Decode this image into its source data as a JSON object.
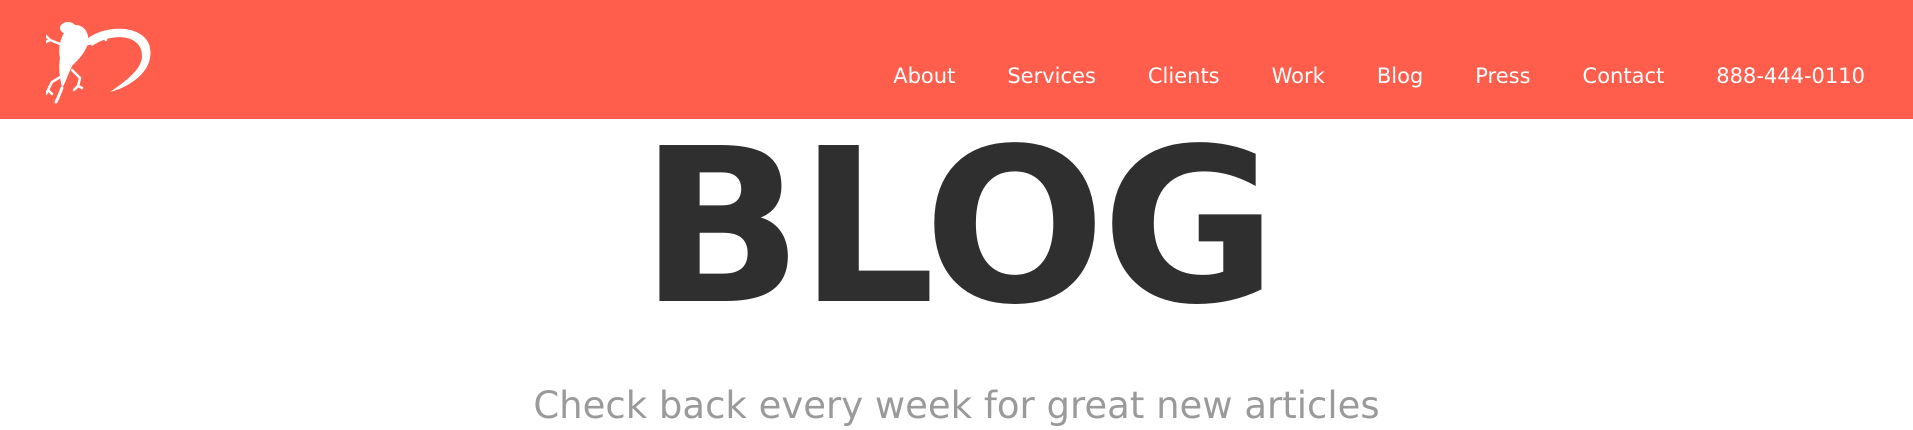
{
  "header": {
    "background_color": "#ff5e4d",
    "logo_icon": "lizard-logo-icon",
    "nav": [
      {
        "label": "About"
      },
      {
        "label": "Services"
      },
      {
        "label": "Clients"
      },
      {
        "label": "Work"
      },
      {
        "label": "Blog"
      },
      {
        "label": "Press"
      },
      {
        "label": "Contact"
      },
      {
        "label": "888-444-0110"
      }
    ]
  },
  "hero": {
    "title": "BLOG",
    "subtitle": "Check back every week for great new articles",
    "title_color": "#2f2f2f",
    "subtitle_color": "#9a9a9a"
  }
}
